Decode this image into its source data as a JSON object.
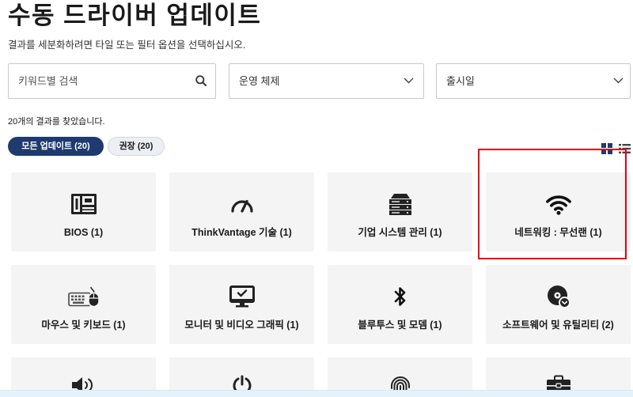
{
  "page": {
    "title": "수동 드라이버 업데이트",
    "subtitle": "결과를 세분화하려면 타일 또는 필터 옵션을 선택하십시오."
  },
  "filters": {
    "search": {
      "placeholder": "키워드별 검색",
      "icon": "search-icon"
    },
    "os": {
      "label": "운영 체제",
      "icon": "chevron-down-icon"
    },
    "release_date": {
      "label": "출시일",
      "icon": "chevron-down-icon"
    }
  },
  "results": {
    "count_text": "20개의 결과를 찾았습니다."
  },
  "pills": [
    {
      "label": "모든 업데이트 (20)",
      "selected": true
    },
    {
      "label": "권장 (20)",
      "selected": false
    }
  ],
  "view_toggle": {
    "grid_active": true,
    "grid_icon": "grid-view-icon",
    "list_icon": "list-view-icon"
  },
  "tiles": [
    {
      "label": "BIOS (1)",
      "icon": "motherboard-icon"
    },
    {
      "label": "ThinkVantage 기술 (1)",
      "icon": "gauge-icon"
    },
    {
      "label": "기업 시스템 관리 (1)",
      "icon": "server-icon"
    },
    {
      "label": "네트워킹 : 무선랜 (1)",
      "icon": "wifi-icon",
      "highlighted": true
    },
    {
      "label": "마우스 및 키보드 (1)",
      "icon": "keyboard-mouse-icon"
    },
    {
      "label": "모니터 및 비디오 그래픽 (1)",
      "icon": "monitor-check-icon"
    },
    {
      "label": "블루투스 및 모뎀 (1)",
      "icon": "bluetooth-icon"
    },
    {
      "label": "소프트웨어 및 유틸리티 (2)",
      "icon": "disc-gear-icon"
    },
    {
      "icon": "speaker-icon"
    },
    {
      "icon": "power-icon"
    },
    {
      "icon": "fingerprint-icon"
    },
    {
      "icon": "toolbox-icon"
    }
  ],
  "colors": {
    "accent": "#1f3a6e",
    "highlight": "#e60012",
    "tile_bg": "#f4f4f4",
    "banner_bg": "#e4f2fb"
  }
}
